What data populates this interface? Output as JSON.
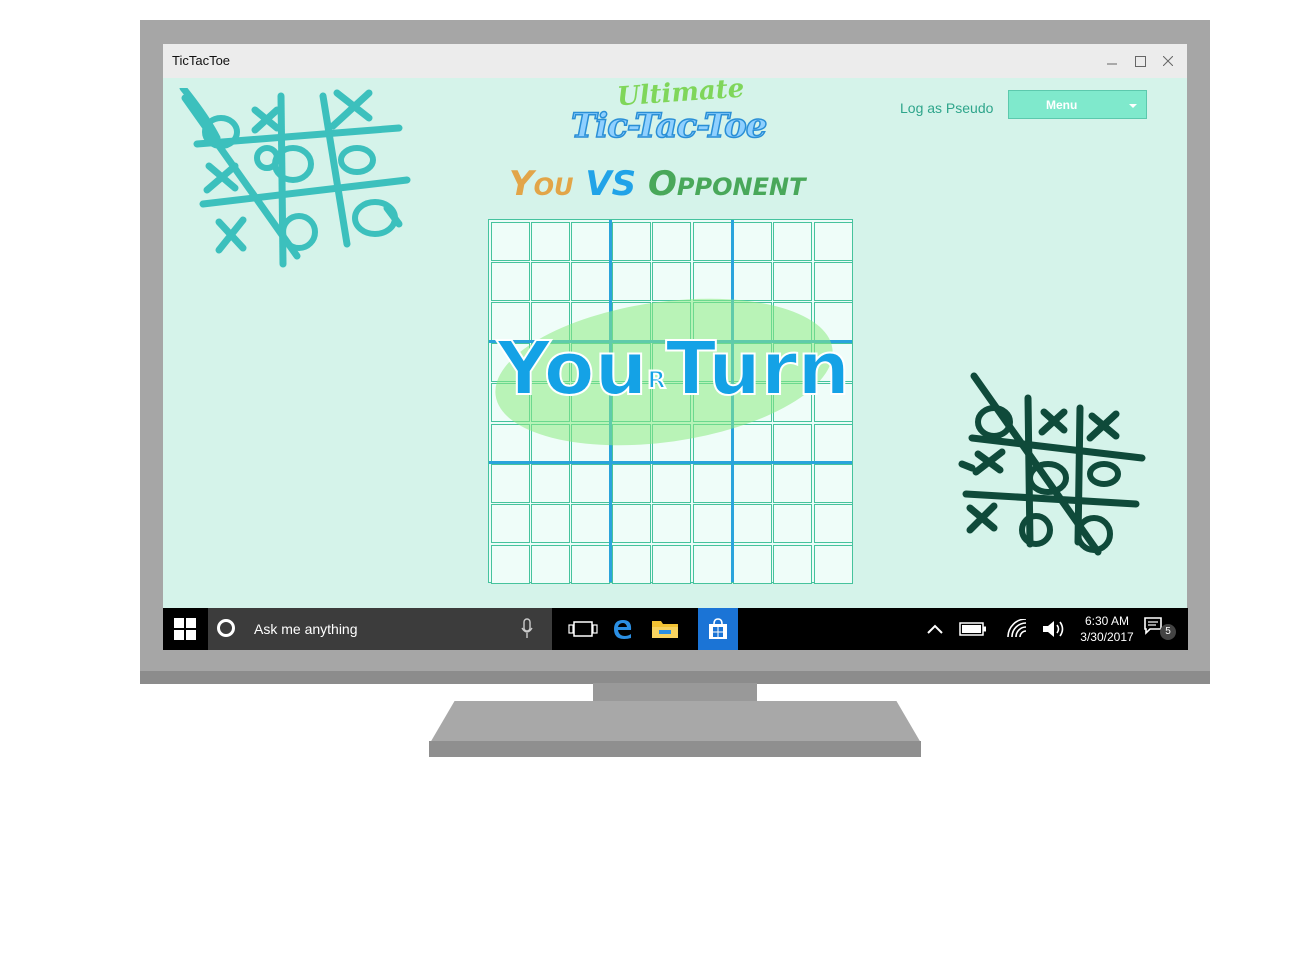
{
  "window": {
    "title": "TicTacToe"
  },
  "header": {
    "login_text": "Log as Pseudo",
    "menu_label": "Menu"
  },
  "logo": {
    "line1": "Ultimate",
    "line2": "Tic-Tac-Toe"
  },
  "matchup": {
    "player": "You",
    "versus": "VS",
    "opponent": "Opponent"
  },
  "board": {
    "rows": 9,
    "cols": 9,
    "turn_prefix": "You",
    "turn_r": "R",
    "turn_suffix": "Turn"
  },
  "taskbar": {
    "search_placeholder": "Ask me anything",
    "time": "6:30 AM",
    "date": "3/30/2017",
    "notification_count": "5"
  },
  "colors": {
    "app_background": "#d5f3ea",
    "accent": "#7fe9cc",
    "board_line": "#2aa4dc",
    "turn_text": "#14a2e6",
    "decor_light": "#3cc0bd",
    "decor_dark": "#0f4a3a"
  }
}
